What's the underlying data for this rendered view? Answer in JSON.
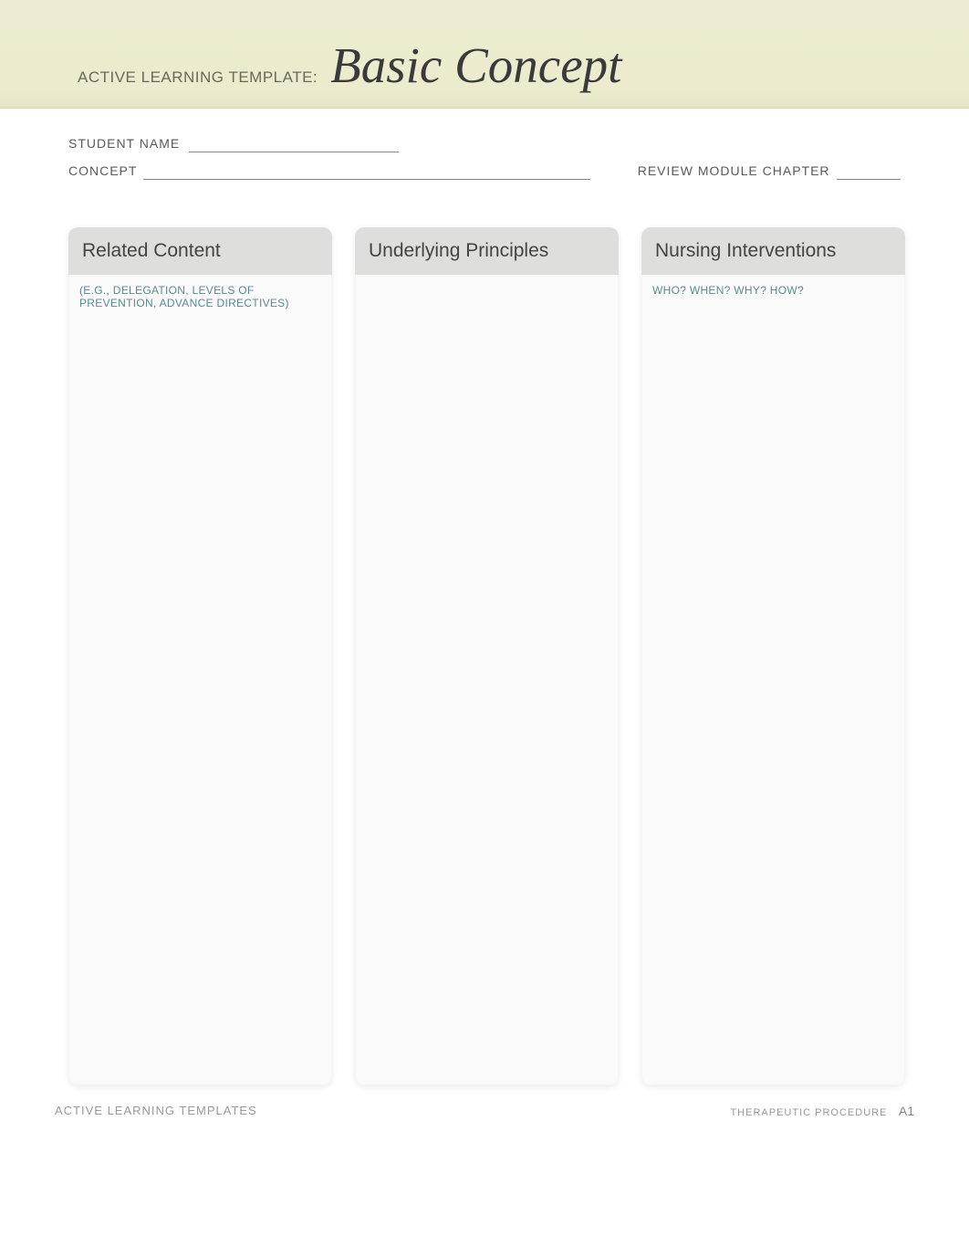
{
  "header": {
    "template_label": "ACTIVE LEARNING TEMPLATE:",
    "template_title": "Basic Concept"
  },
  "fields": {
    "student_name_label": "STUDENT NAME",
    "student_name_value": "",
    "concept_label": "CONCEPT",
    "concept_value": "",
    "review_module_label": "REVIEW MODULE CHAPTER",
    "review_module_value": ""
  },
  "columns": {
    "related_content": {
      "title": "Related Content",
      "subtitle": "(E.G., DELEGATION, LEVELS OF PREVENTION, ADVANCE DIRECTIVES)",
      "body": ""
    },
    "underlying_principles": {
      "title": "Underlying Principles",
      "subtitle": "",
      "body": ""
    },
    "nursing_interventions": {
      "title": "Nursing Interventions",
      "subtitle": "WHO? WHEN? WHY? HOW?",
      "body": ""
    }
  },
  "footer": {
    "left": "ACTIVE LEARNING TEMPLATES",
    "right": "THERAPEUTIC PROCEDURE",
    "code": "A1"
  }
}
